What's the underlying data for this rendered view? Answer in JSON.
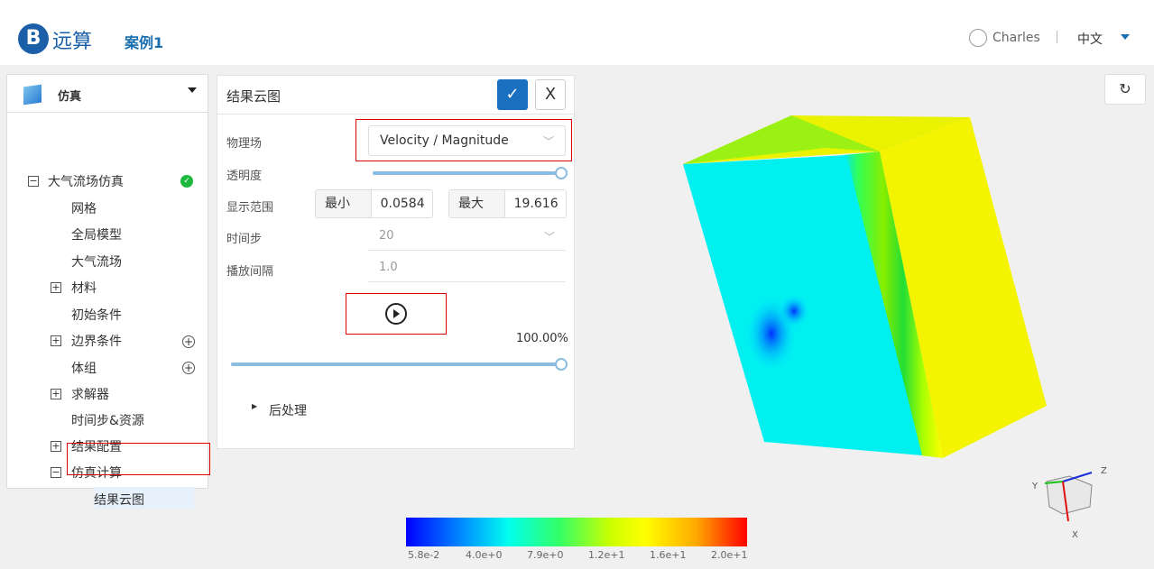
{
  "header": {
    "logo_text": "远算",
    "case_name": "案例1",
    "user": "Charles",
    "language": "中文"
  },
  "sidebar": {
    "title": "仿真",
    "items": [
      {
        "label": "大气流场仿真",
        "status": "complete"
      },
      {
        "label": "网格"
      },
      {
        "label": "全局模型"
      },
      {
        "label": "大气流场"
      },
      {
        "label": "材料"
      },
      {
        "label": "初始条件"
      },
      {
        "label": "边界条件"
      },
      {
        "label": "体组"
      },
      {
        "label": "求解器"
      },
      {
        "label": "时间步&资源"
      },
      {
        "label": "结果配置"
      },
      {
        "label": "仿真计算"
      },
      {
        "label": "结果云图",
        "selected": true
      }
    ]
  },
  "panel": {
    "title": "结果云图",
    "confirm_icon": "check",
    "close_label": "X",
    "field_label": "物理场",
    "field_value": "Velocity / Magnitude",
    "opacity_label": "透明度",
    "opacity": 1.0,
    "range_label": "显示范围",
    "min_label": "最小值",
    "min_value": "0.0584",
    "max_label": "最大值",
    "max_value": "19.616",
    "timestep_label": "时间步",
    "timestep_value": "20",
    "interval_label": "播放间隔",
    "interval_value": "1.0",
    "progress_text": "100.00%",
    "progress": 1.0,
    "postprocess_label": "后处理"
  },
  "colorbar": {
    "labels": [
      "5.8e-2",
      "4.0e+0",
      "7.9e+0",
      "1.2e+1",
      "1.6e+1",
      "2.0e+1"
    ]
  },
  "axes": {
    "x": "X",
    "y": "Y",
    "z": "Z"
  },
  "colors": {
    "accent": "#1a6fc0",
    "highlight": "#e00000"
  }
}
